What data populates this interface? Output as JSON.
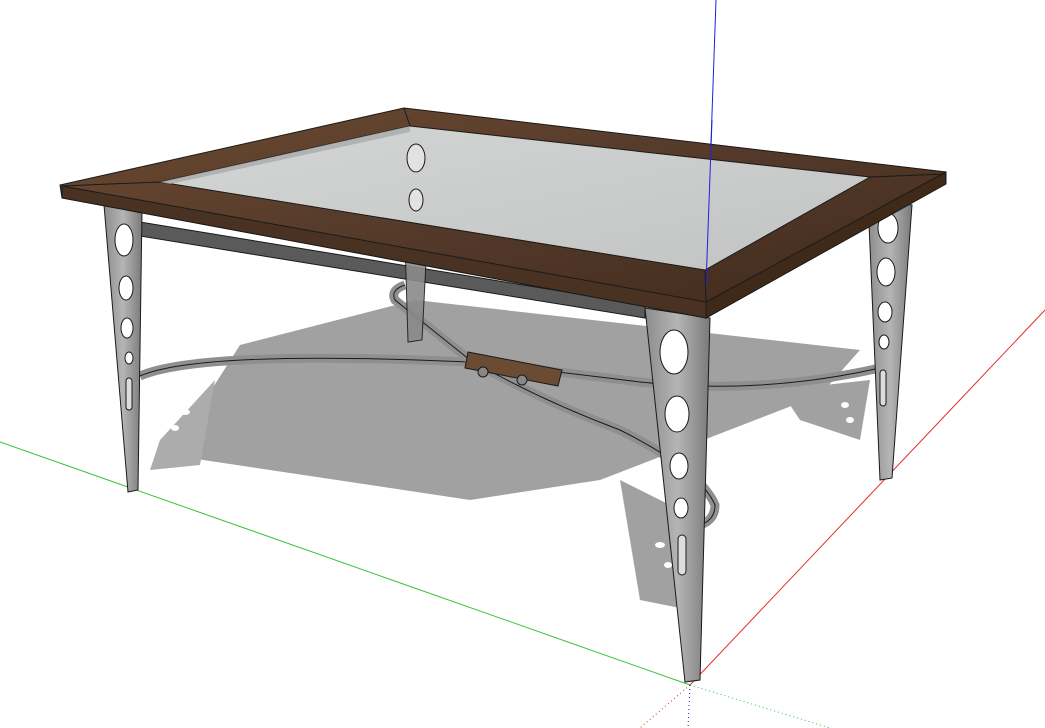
{
  "scene": {
    "background_color": "#ffffff",
    "model_name": "coffee-table",
    "axes": {
      "red_color": "#e0302c",
      "green_color": "#39c23a",
      "blue_color": "#1e22d9"
    },
    "materials": {
      "wood_color": "#5a3e28",
      "wood_dark_color": "#3f2a1a",
      "glass_color": "#c9cbcb",
      "metal_color": "#a7a7a7",
      "metal_dark_color": "#6f6f6f",
      "shadow_color": "#9a9a9a",
      "outline_color": "#1a1a1a"
    }
  }
}
